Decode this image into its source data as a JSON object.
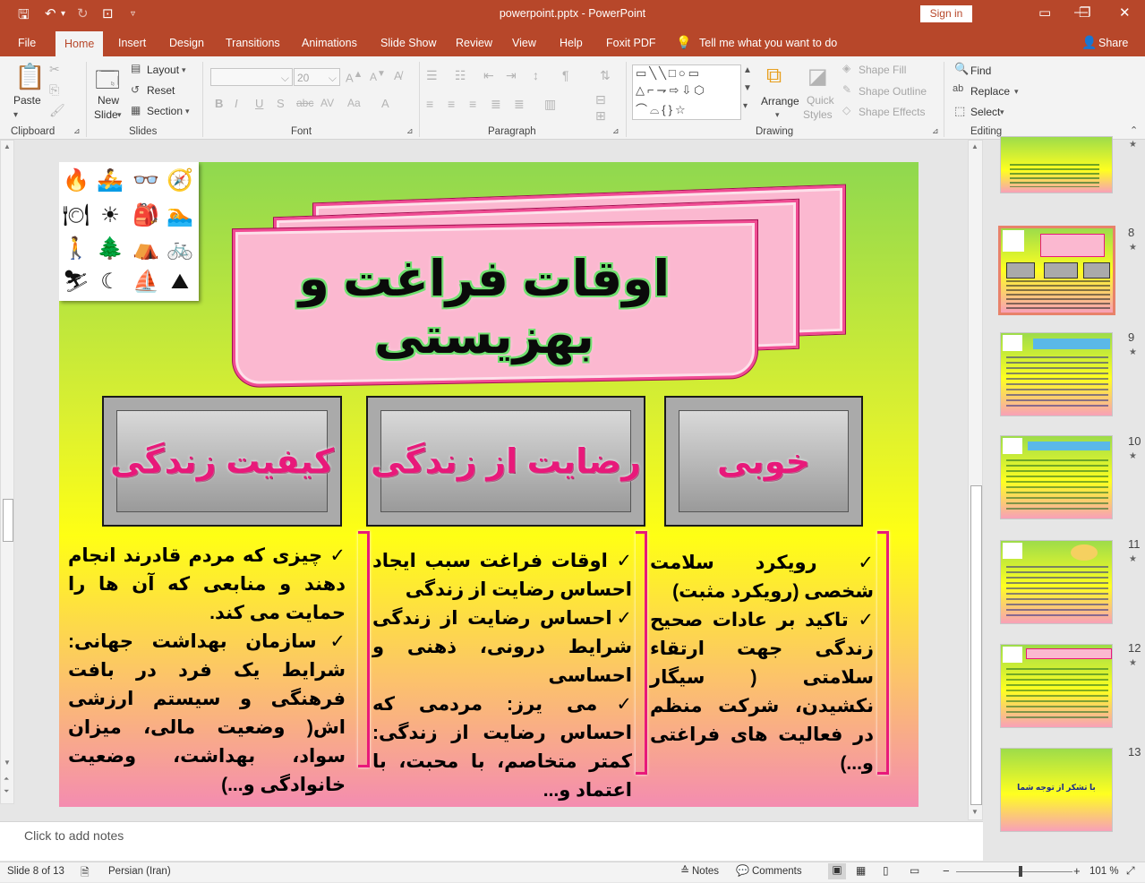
{
  "app": {
    "document_title": "powerpoint.pptx  -  PowerPoint",
    "sign_in": "Sign in"
  },
  "menu": {
    "tabs": [
      "File",
      "Home",
      "Insert",
      "Design",
      "Transitions",
      "Animations",
      "Slide Show",
      "Review",
      "View",
      "Help",
      "Foxit PDF"
    ],
    "tell_me": "Tell me what you want to do",
    "share": "Share"
  },
  "ribbon": {
    "clipboard": {
      "label": "Clipboard",
      "paste": "Paste"
    },
    "slides": {
      "label": "Slides",
      "new_slide_1": "New",
      "new_slide_2": "Slide",
      "layout": "Layout",
      "reset": "Reset",
      "section": "Section"
    },
    "font": {
      "label": "Font",
      "size": "20"
    },
    "paragraph": {
      "label": "Paragraph"
    },
    "drawing": {
      "label": "Drawing",
      "arrange": "Arrange",
      "quick_styles_1": "Quick",
      "quick_styles_2": "Styles",
      "shape_fill": "Shape Fill",
      "shape_outline": "Shape Outline",
      "shape_effects": "Shape Effects"
    },
    "editing": {
      "label": "Editing",
      "find": "Find",
      "replace": "Replace",
      "select": "Select"
    }
  },
  "slide": {
    "title": "اوقات فراغت و بهزیستی",
    "boxes": [
      "کیفیت زندگی",
      "رضایت از زندگی",
      "خوبی"
    ],
    "col_quality": [
      "✓ چیزی که مردم قادرند انجام دهند و منابعی که آن ها را حمایت می کند.",
      "✓سازمان بهداشت جهانی: شرایط یک فرد در بافت فرهنگی و سیستم ارزشی اش( وضعیت مالی، میزان سواد، بهداشت، وضعیت خانوادگی و...)"
    ],
    "col_satisfaction": [
      "✓ اوقات فراغت سبب ایجاد احساس رضایت از زندگی",
      "✓احساس رضایت از زندگی شرایط درونی، ذهنی و احساسی",
      "✓می یرز: مردمی که احساس رضایت از زندگی: کمتر متخاصم، با محبت، با اعتماد و..."
    ],
    "col_wellness": [
      "✓ رویکرد سلامت شخصی (رویکرد مثبت)",
      "✓ تاکید بر عادات صحیح زندگی جهت ارتقاء سلامتی ( سیگار نکشیدن، شرکت منظم در فعالیت های فراغتی و...)"
    ]
  },
  "notes": {
    "placeholder": "Click to add notes"
  },
  "thumbnails": [
    {
      "num": "",
      "star": "★"
    },
    {
      "num": "8",
      "star": "★"
    },
    {
      "num": "9",
      "star": "★"
    },
    {
      "num": "10",
      "star": "★"
    },
    {
      "num": "11",
      "star": "★"
    },
    {
      "num": "12",
      "star": "★"
    },
    {
      "num": "13",
      "star": ""
    }
  ],
  "thumb13_text": "با تشکر از توجه شما",
  "status": {
    "slide_of": "Slide 8 of 13",
    "language": "Persian (Iran)",
    "notes": "Notes",
    "comments": "Comments",
    "zoom": "101 %"
  }
}
